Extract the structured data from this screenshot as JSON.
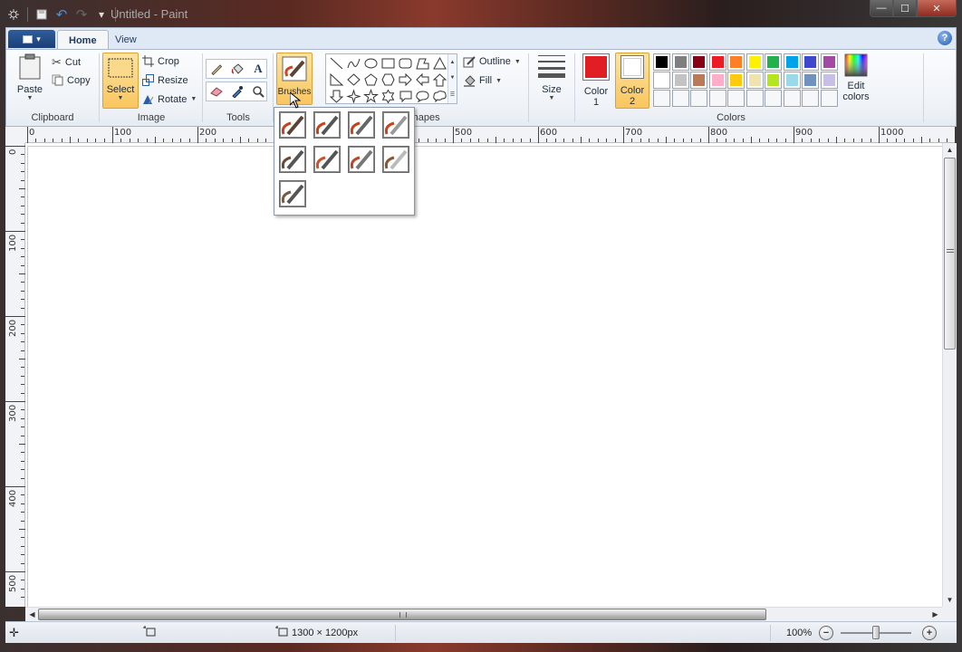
{
  "window": {
    "title": "Untitled - Paint",
    "controls": {
      "minimize": "—",
      "maximize": "☐",
      "close": "✕"
    }
  },
  "quick_access": [
    {
      "name": "save",
      "glyph": "▪"
    },
    {
      "name": "undo",
      "glyph": "↶"
    },
    {
      "name": "redo",
      "glyph": "↷"
    },
    {
      "name": "customize",
      "glyph": "▾"
    }
  ],
  "tabs": {
    "file_caret": "▾",
    "items": [
      {
        "label": "Home",
        "active": true
      },
      {
        "label": "View",
        "active": false
      }
    ],
    "help": "?"
  },
  "ribbon": {
    "clipboard": {
      "label": "Clipboard",
      "paste": "Paste",
      "cut": "Cut",
      "copy": "Copy"
    },
    "image": {
      "label": "Image",
      "select": "Select",
      "crop": "Crop",
      "resize": "Resize",
      "rotate": "Rotate"
    },
    "tools": {
      "label": "Tools",
      "items": [
        "pencil",
        "fill",
        "text",
        "eraser",
        "color-picker",
        "magnifier"
      ]
    },
    "brushes": {
      "label": "Brushes"
    },
    "shapes": {
      "label": "Shapes",
      "items": [
        "line",
        "curve",
        "oval",
        "rectangle",
        "rounded-rectangle",
        "polygon",
        "triangle",
        "right-triangle",
        "diamond",
        "pentagon",
        "hexagon",
        "right-arrow",
        "left-arrow",
        "up-arrow",
        "down-arrow",
        "four-point-star",
        "five-point-star",
        "six-point-star",
        "rounded-rect-callout",
        "oval-callout",
        "cloud-callout"
      ],
      "outline": "Outline",
      "fill": "Fill"
    },
    "size": {
      "label": "Size"
    },
    "colors": {
      "label": "Colors",
      "color1": {
        "label": "Color",
        "num": "1",
        "value": "#e01e24"
      },
      "color2": {
        "label": "Color",
        "num": "2",
        "value": "#ffffff"
      },
      "edit": "Edit colors",
      "palette_row1": [
        "#000000",
        "#7f7f7f",
        "#880015",
        "#ed1c24",
        "#ff7f27",
        "#fff200",
        "#22b14c",
        "#00a2e8",
        "#3f48cc",
        "#a349a4"
      ],
      "palette_row2": [
        "#ffffff",
        "#c3c3c3",
        "#b97a57",
        "#ffaec9",
        "#ffc90e",
        "#efe4b0",
        "#b5e61d",
        "#99d9ea",
        "#7092be",
        "#c8bfe7"
      ],
      "palette_row3_count": 10
    }
  },
  "brush_dropdown": {
    "items": [
      "Brush",
      "Calligraphy brush 1",
      "Calligraphy brush 2",
      "Airbrush",
      "Oil brush",
      "Crayon",
      "Marker",
      "Natural pencil",
      "Watercolor brush"
    ]
  },
  "rulers": {
    "horizontal": [
      "0",
      "100",
      "200",
      "300",
      "400",
      "500",
      "600",
      "700",
      "800",
      "900",
      "1000"
    ],
    "vertical": [
      "0",
      "100",
      "200",
      "300",
      "400",
      "500"
    ]
  },
  "statusbar": {
    "selection_size": "",
    "canvas_size": "1300 × 1200px",
    "zoom": "100%",
    "zoom_level_percent": 100,
    "zoom_out": "−",
    "zoom_in": "+"
  }
}
